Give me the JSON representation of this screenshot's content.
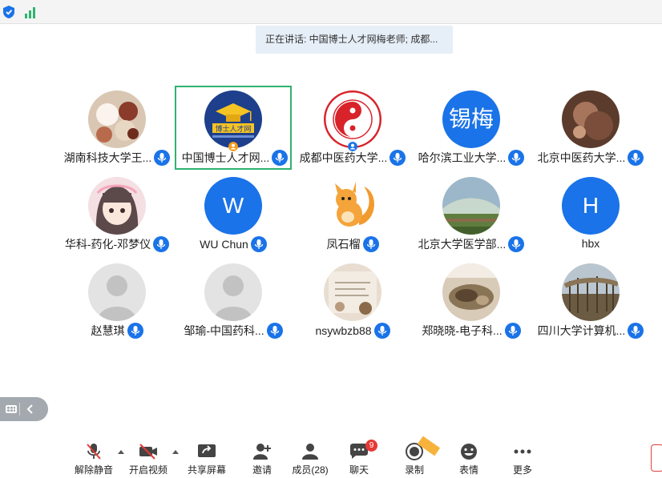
{
  "top_bar": {
    "security_icon": "shield-check-icon",
    "signal_icon": "signal-bars-icon"
  },
  "speaking_banner": "正在讲话: 中国博士人才网梅老师; 成都...",
  "participants": [
    {
      "name": "湖南科技大学王...",
      "avatar": "photo-cakes",
      "mic": "mic-icon"
    },
    {
      "name": "中国博士人才网...",
      "avatar": "logo-boshi",
      "mic": "mic-icon",
      "active": true
    },
    {
      "name": "成都中医药大学...",
      "avatar": "logo-cdutcm",
      "mic": "mic-icon"
    },
    {
      "name": "哈尔滨工业大学...",
      "avatar_text": "锡梅",
      "mic": "mic-icon"
    },
    {
      "name": "北京中医药大学...",
      "avatar": "photo-dark",
      "mic": "mic-icon"
    },
    {
      "name": "华科-药化-邓梦仪",
      "avatar": "anime-girl",
      "mic": "mic-icon"
    },
    {
      "name": "WU Chun",
      "avatar_text": "W",
      "mic": "mic-icon"
    },
    {
      "name": "凤石榴",
      "avatar": "cartoon-squirrel",
      "mic": "mic-icon"
    },
    {
      "name": "北京大学医学部...",
      "avatar": "photo-landscape",
      "mic": "mic-icon"
    },
    {
      "name": "hbx",
      "avatar_text": "H"
    },
    {
      "name": "赵慧琪",
      "avatar": "default-person",
      "mic": "mic-icon"
    },
    {
      "name": "邹瑜-中国药科...",
      "avatar": "default-person",
      "mic": "mic-icon"
    },
    {
      "name": "nsywbzb88",
      "avatar": "photo-paper",
      "mic": "mic-icon"
    },
    {
      "name": "郑晓晓-电子科...",
      "avatar": "photo-cat",
      "mic": "mic-icon"
    },
    {
      "name": "四川大学计算机...",
      "avatar": "photo-trees",
      "mic": "mic-icon"
    }
  ],
  "toolbar": {
    "unmute": "解除静音",
    "start_video": "开启视频",
    "share_screen": "共享屏幕",
    "invite": "邀请",
    "members": "成员(28)",
    "chat": "聊天",
    "chat_badge": "9",
    "record": "录制",
    "reactions": "表情",
    "more": "更多"
  },
  "colors": {
    "accent": "#1a73e8",
    "active_border": "#2fb36f",
    "badge": "#e53935"
  }
}
